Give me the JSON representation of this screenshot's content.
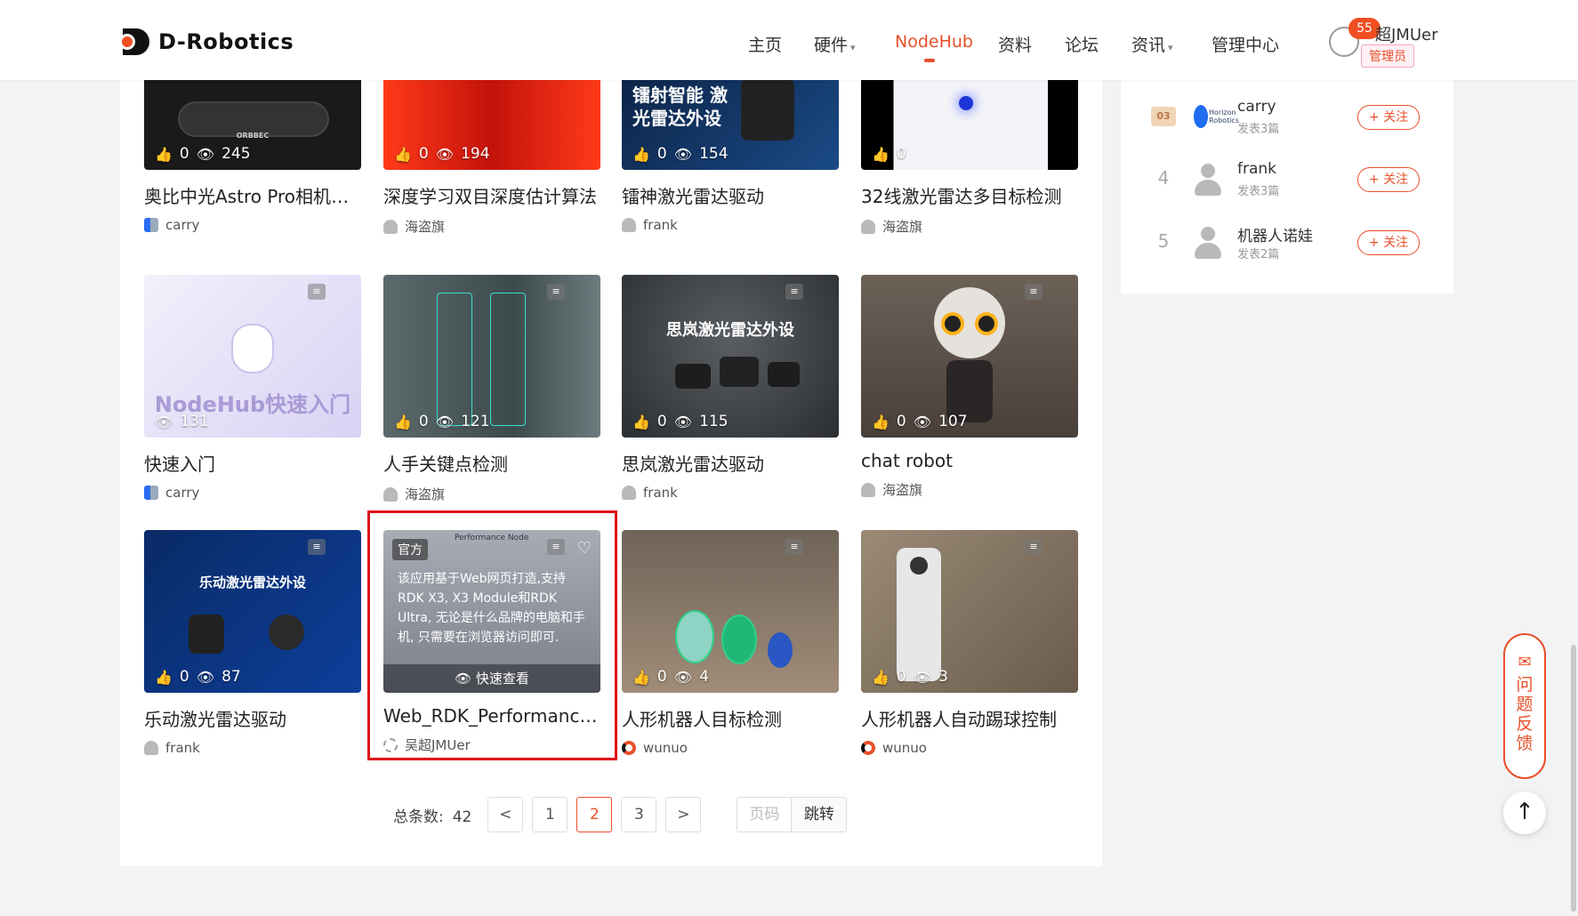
{
  "header": {
    "brand": "D-Robotics",
    "nav": [
      {
        "label": "主页"
      },
      {
        "label": "硬件",
        "caret": "▾"
      },
      {
        "label": "NodeHub"
      },
      {
        "label": "资料"
      },
      {
        "label": "论坛"
      },
      {
        "label": "资讯",
        "caret": "▾"
      },
      {
        "label": "管理中心"
      }
    ],
    "active_nav": "NodeHub",
    "user": {
      "badge": "55",
      "name": "超JMUer",
      "role": "管理员"
    }
  },
  "cards": [
    {
      "title": "奥比中光Astro Pro相机驱动",
      "author": "carry",
      "likes": "0",
      "views": "245",
      "thumb_bg": "#1a1a1a",
      "thumb_text": "ORBBEC"
    },
    {
      "title": "深度学习双目深度估计算法",
      "author": "海盗旗",
      "likes": "0",
      "views": "194",
      "thumb_bg": "#d01a10",
      "thumb_text": ""
    },
    {
      "title": "镭神激光雷达驱动",
      "author": "frank",
      "likes": "0",
      "views": "154",
      "thumb_bg": "#0d2748",
      "thumb_text": "镭射智能 激光雷达外设"
    },
    {
      "title": "32线激光雷达多目标检测",
      "author": "海盗旗",
      "likes": "0",
      "views": "",
      "thumb_bg": "#f4f4f8",
      "thumb_text": ""
    },
    {
      "title": "快速入门",
      "author": "carry",
      "likes": "",
      "views": "131",
      "thumb_bg": "#e8e3f7",
      "thumb_text": "NodeHub快速入门"
    },
    {
      "title": "人手关键点检测",
      "author": "海盗旗",
      "likes": "0",
      "views": "121",
      "thumb_bg": "#4b5a5e",
      "thumb_text": ""
    },
    {
      "title": "思岚激光雷达驱动",
      "author": "frank",
      "likes": "0",
      "views": "115",
      "thumb_bg": "#3a3d40",
      "thumb_text": "思岚激光雷达外设"
    },
    {
      "title": "chat robot",
      "author": "海盗旗",
      "likes": "0",
      "views": "107",
      "thumb_bg": "#6f5f53",
      "thumb_text": ""
    },
    {
      "title": "乐动激光雷达驱动",
      "author": "frank",
      "likes": "0",
      "views": "87",
      "thumb_bg": "#0b2d6b",
      "thumb_text": "乐动激光雷达外设"
    },
    {
      "title": "Web_RDK_Performance_N...",
      "author": "吴超JMUer",
      "likes": "",
      "views": "",
      "thumb_bg": "#8b8e98",
      "thumb_text": ""
    },
    {
      "title": "人形机器人目标检测",
      "author": "wunuo",
      "likes": "0",
      "views": "4",
      "thumb_bg": "#7d6c5e",
      "thumb_text": ""
    },
    {
      "title": "人形机器人自动踢球控制",
      "author": "wunuo",
      "likes": "0",
      "views": "3",
      "thumb_bg": "#8a7a69",
      "thumb_text": ""
    }
  ],
  "highlight_card": {
    "tag": "官方",
    "overlay_text": "该应用基于Web网页打造,支持RDK X3, X3 Module和RDK Ultra, 无论是什么品牌的电脑和手机, 只需要在浏览器访问即可.",
    "quick_view": "快速查看",
    "thumb_header": "Performance Node"
  },
  "pagination": {
    "total_label": "总条数:",
    "total": "42",
    "prev": "<",
    "next": ">",
    "pages": [
      "1",
      "2",
      "3"
    ],
    "current": "2",
    "jump_placeholder": "页码",
    "jump_button": "跳转"
  },
  "ranking": [
    {
      "rank": "03",
      "name": "carry",
      "posts": "发表3篇",
      "follow": "+ 关注"
    },
    {
      "rank": "4",
      "name": "frank",
      "posts": "发表3篇",
      "follow": "+ 关注"
    },
    {
      "rank": "5",
      "name": "机器人诺娃",
      "posts": "发表2篇",
      "follow": "+ 关注"
    }
  ],
  "floating": {
    "feedback_label": "问题反馈",
    "to_top_icon": "↑"
  },
  "colors": {
    "accent": "#e8502a",
    "highlight_border": "#e0121b"
  }
}
